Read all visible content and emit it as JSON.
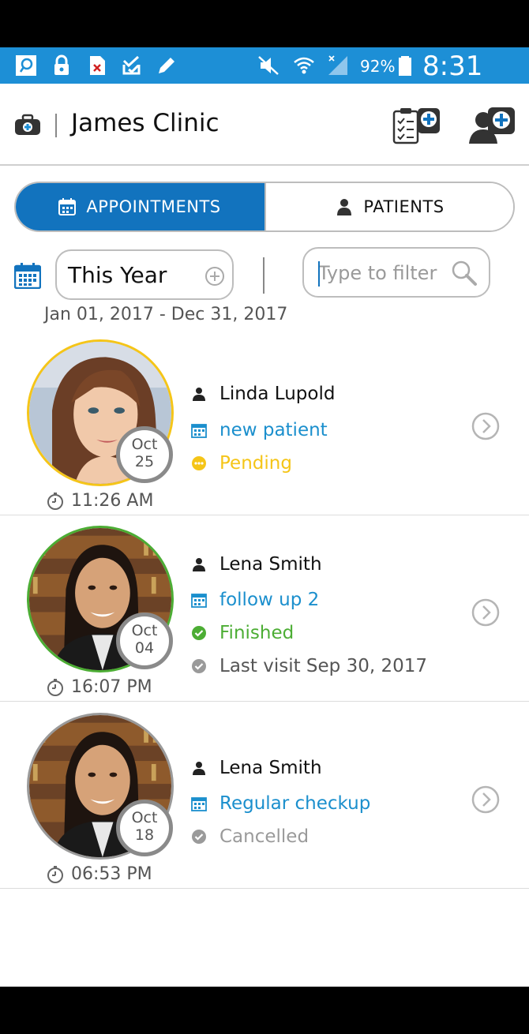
{
  "status_bar": {
    "battery": "92%",
    "time": "8:31 PM",
    "colors": {
      "background": "#1d8fd6"
    }
  },
  "header": {
    "title": "James Clinic",
    "icons": [
      "medkit-icon",
      "add-appointment-icon",
      "add-patient-icon"
    ]
  },
  "tabs": [
    {
      "label": "APPOINTMENTS",
      "icon": "calendar-icon",
      "active": true
    },
    {
      "label": "PATIENTS",
      "icon": "person-icon",
      "active": false
    }
  ],
  "filter": {
    "period": "This Year",
    "search_placeholder": "Type to filter",
    "date_range": "Jan 01, 2017 - Dec 31, 2017"
  },
  "appointments": [
    {
      "name": "Linda Lupold",
      "type": "new patient",
      "status": "Pending",
      "status_color": "#f5c518",
      "month": "Oct",
      "day": "25",
      "time": "11:26 AM",
      "ring_color": "#f5c518"
    },
    {
      "name": "Lena Smith",
      "type": "follow up 2",
      "status": "Finished",
      "status_color": "#4cad34",
      "last_visit": "Last visit Sep 30, 2017",
      "month": "Oct",
      "day": "04",
      "time": "16:07 PM",
      "ring_color": "#4cad34"
    },
    {
      "name": "Lena Smith",
      "type": "Regular checkup",
      "status": "Cancelled",
      "status_color": "#9a9a9a",
      "month": "Oct",
      "day": "18",
      "time": "06:53 PM",
      "ring_color": "#9a9a9a"
    }
  ],
  "colors": {
    "accent": "#1273be",
    "link": "#1b8fcd"
  }
}
